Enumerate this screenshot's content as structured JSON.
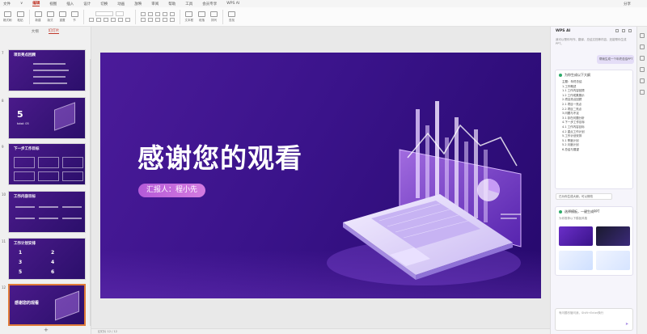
{
  "menubar": {
    "items": [
      "文件",
      "∨",
      "编辑",
      "视图",
      "插入",
      "设计",
      "切换",
      "动画",
      "放映",
      "审阅",
      "帮助",
      "工具",
      "会员专享"
    ],
    "active_index": 2,
    "search": "WPS AI",
    "right_items": [
      "分享"
    ]
  },
  "ribbon": {
    "groups": [
      "格式刷",
      "粘贴",
      "新建",
      "版式",
      "重置",
      "节",
      "文本框",
      "段落",
      "排列",
      "查找"
    ]
  },
  "leftpanel": {
    "tabs": [
      "大纲",
      "幻灯片"
    ],
    "active_tab": 1,
    "thumbnails": [
      {
        "num": "7",
        "title": "项目亮点回顾"
      },
      {
        "num": "8",
        "big": "5",
        "sub": "total: 05"
      },
      {
        "num": "9",
        "title": "下一步工作目标"
      },
      {
        "num": "10",
        "title": "工作内容目标"
      },
      {
        "num": "11",
        "title": "工作计划安排",
        "nums": [
          "1",
          "2",
          "3",
          "4",
          "5",
          "6"
        ]
      },
      {
        "num": "12",
        "title": "感谢您的观看"
      }
    ]
  },
  "slide": {
    "title": "感谢您的观看",
    "reporter": "汇报人：程小先"
  },
  "status": {
    "text": "幻灯片 12 / 12"
  },
  "assistant": {
    "title": "WPS AI",
    "intro": "我可以帮你写作、翻译、总结文档等内容，还能帮你生成PPT。",
    "user_msg": "帮我生成一个年终总结PPT",
    "outline_header": "为你生成以下大纲",
    "outline": [
      "主题：年终总结",
      "1.工作概述",
      "1.1 工作内容回顾",
      "1.2 工作成果展示",
      "2.项目亮点回顾",
      "2.1 项目一亮点",
      "2.2 项目二亮点",
      "3.问题与不足",
      "3.1 存在问题分析",
      "4.下一步工作目标",
      "4.1 工作内容目标",
      "4.2 重点工作计划",
      "5.工作计划安排",
      "5.1 季度计划",
      "5.2 月度计划",
      "6.总结与展望"
    ],
    "chip": "已为你生成大纲，可以修改",
    "template_header": "选择模板，一键生成PPT",
    "template_sub": "为你推荐以下模板风格",
    "input_placeholder": "有问题尽管问我，Shift+Enter换行"
  },
  "colors": {
    "accent": "#c0392b",
    "slide_bg": "#3a138a",
    "pill": "#c868dc"
  }
}
